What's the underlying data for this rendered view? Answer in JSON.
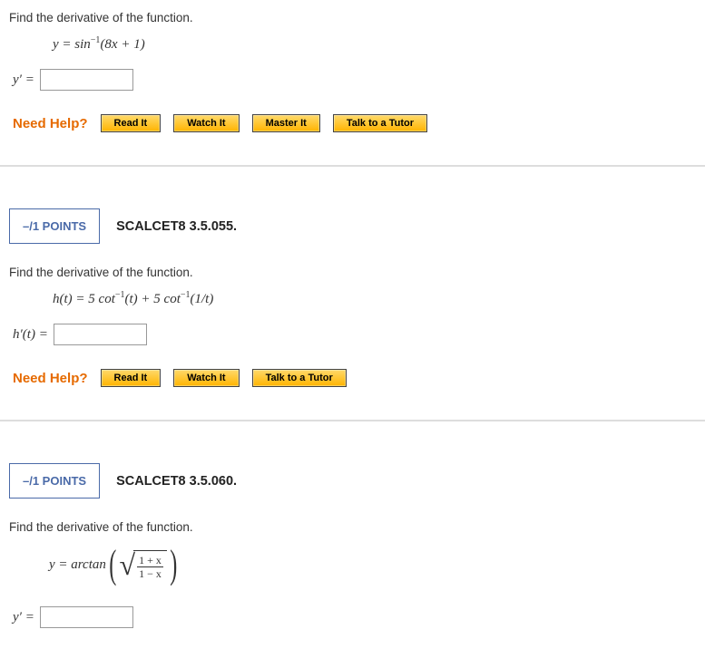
{
  "problem1": {
    "prompt": "Find the derivative of the function.",
    "equation_prefix": "y = sin",
    "equation_sup": "−1",
    "equation_suffix": "(8x + 1)",
    "answer_label": "y′ =",
    "answer_value": "",
    "help_label": "Need Help?",
    "buttons": {
      "read": "Read It",
      "watch": "Watch It",
      "master": "Master It",
      "tutor": "Talk to a Tutor"
    }
  },
  "problem2": {
    "points": "–/1 POINTS",
    "reference": "SCALCET8 3.5.055.",
    "prompt": "Find the derivative of the function.",
    "equation_prefix": "h(t) = 5 cot",
    "equation_sup1": "−1",
    "equation_mid": "(t) + 5 cot",
    "equation_sup2": "−1",
    "equation_suffix": "(1/t)",
    "answer_label": "h′(t) =",
    "answer_value": "",
    "help_label": "Need Help?",
    "buttons": {
      "read": "Read It",
      "watch": "Watch It",
      "tutor": "Talk to a Tutor"
    }
  },
  "problem3": {
    "points": "–/1 POINTS",
    "reference": "SCALCET8 3.5.060.",
    "prompt": "Find the derivative of the function.",
    "eq_lhs": "y = arctan",
    "frac_num": "1 + x",
    "frac_den": "1 − x",
    "answer_label": "y′ =",
    "answer_value": ""
  }
}
